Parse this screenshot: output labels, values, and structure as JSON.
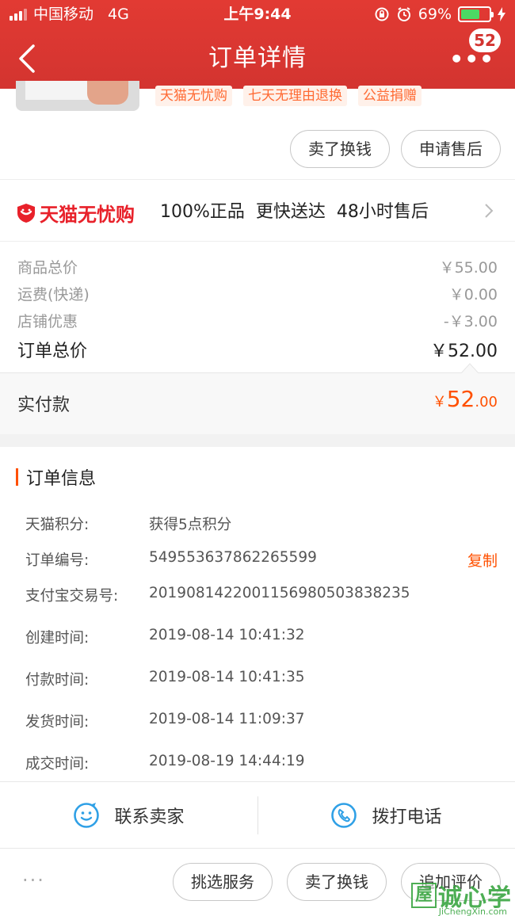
{
  "status_bar": {
    "carrier": "中国移动",
    "network": "4G",
    "time": "上午9:44",
    "battery": "69%",
    "battery_level": 0.69
  },
  "nav": {
    "title": "订单详情",
    "badge": "52"
  },
  "product": {
    "tags": [
      "天猫无忧购",
      "七天无理由退换",
      "公益捐赠"
    ]
  },
  "actions": {
    "sell_exchange": "卖了换钱",
    "after_sale": "申请售后"
  },
  "assurance": {
    "brand": "天猫无忧购",
    "text": "100%正品  更快送达  48小时售后"
  },
  "prices": {
    "goods_total_label": "商品总价",
    "goods_total_value": "￥55.00",
    "shipping_label": "运费(快递)",
    "shipping_value": "￥0.00",
    "discount_label": "店铺优惠",
    "discount_value": "-￥3.00",
    "order_total_label": "订单总价",
    "order_total_value": "￥52.00",
    "paid_label": "实付款",
    "paid_symbol": "￥",
    "paid_int": "52",
    "paid_dec": ".00"
  },
  "order_info": {
    "title": "订单信息",
    "rows": [
      {
        "label": "天猫积分:",
        "value": "获得5点积分"
      },
      {
        "label": "订单编号:",
        "value": "549553637862265599"
      },
      {
        "label": "支付宝交易号:",
        "value": "2019081422001156980503838235"
      },
      {
        "label": "创建时间:",
        "value": "2019-08-14 10:41:32"
      },
      {
        "label": "付款时间:",
        "value": "2019-08-14 10:41:35"
      },
      {
        "label": "发货时间:",
        "value": "2019-08-14 11:09:37"
      },
      {
        "label": "成交时间:",
        "value": "2019-08-19 14:44:19"
      }
    ],
    "copy": "复制"
  },
  "contact": {
    "seller": "联系卖家",
    "phone": "拨打电话"
  },
  "bottom": {
    "more": "···",
    "select_service": "挑选服务",
    "sell_exchange": "卖了换钱",
    "add_review": "追加评价"
  },
  "watermark": {
    "box": "屋",
    "text": "诚心学",
    "url": "JiChengXin.com"
  },
  "colors": {
    "brand_red": "#d33430",
    "accent_orange": "#ff5000",
    "tag_bg": "#fff1ea"
  }
}
